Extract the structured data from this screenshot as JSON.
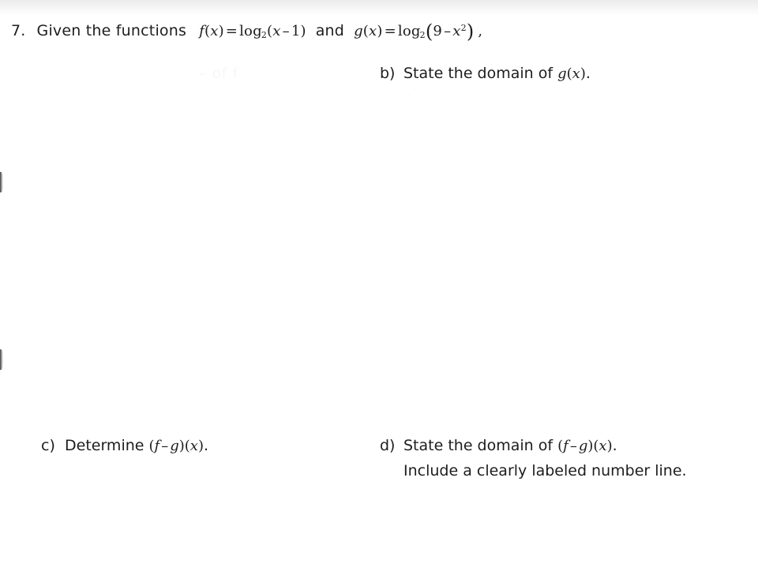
{
  "document": {
    "type": "math-worksheet-scan",
    "background_color": "#ffffff",
    "ink_color": "#1d1d1d",
    "top_shade_color": "#ececec"
  },
  "question": {
    "number": "7.",
    "stem_words": "Given the functions",
    "conjunction": "and",
    "f_definition": {
      "name": "f",
      "arg": "x",
      "equals": "=",
      "log": "log",
      "base": "2",
      "open": "(",
      "inner_var": "x",
      "minus": "–",
      "inner_const": "1",
      "close": ")"
    },
    "g_definition": {
      "name": "g",
      "arg": "x",
      "equals": "=",
      "log": "log",
      "base": "2",
      "open": "(",
      "inner_const": "9",
      "minus": "–",
      "inner_var": "x",
      "exponent": "2",
      "close": ")",
      "trailing_comma": ","
    }
  },
  "parts": {
    "b": {
      "label": "b)",
      "text": "State the domain of ",
      "expr_fn": "g",
      "expr_open": "(",
      "expr_var": "x",
      "expr_close": ")",
      "period": "."
    },
    "c": {
      "label": "c)",
      "text": "Determine ",
      "expr_open1": "(",
      "expr_f": "f",
      "expr_minus": "–",
      "expr_g": "g",
      "expr_close1": ")",
      "expr_open2": "(",
      "expr_var": "x",
      "expr_close2": ")",
      "period": "."
    },
    "d": {
      "label": "d)",
      "text": "State the domain of ",
      "expr_open1": "(",
      "expr_f": "f",
      "expr_minus": "–",
      "expr_g": "g",
      "expr_close1": ")",
      "expr_open2": "(",
      "expr_var": "x",
      "expr_close2": ")",
      "period": ".",
      "second_line": "Include a clearly labeled number line."
    }
  },
  "artifacts": {
    "ghost_text": "– of f",
    "ghost_row": "· · · ·"
  }
}
